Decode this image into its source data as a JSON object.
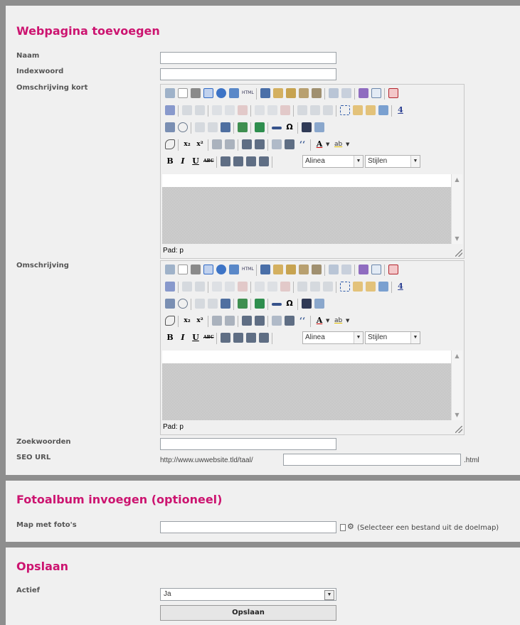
{
  "page": {
    "section_titles": {
      "add_page": "Webpagina toevoegen",
      "photo_album": "Fotoalbum invoegen (optioneel)",
      "save": "Opslaan"
    },
    "labels": {
      "name": "Naam",
      "index_word": "Indexwoord",
      "short_description": "Omschrijving kort",
      "description": "Omschrijving",
      "keywords": "Zoekwoorden",
      "seo_url": "SEO URL",
      "photo_folder": "Map met foto's",
      "active": "Actief"
    },
    "fields": {
      "name": "",
      "index_word": "",
      "keywords": "",
      "seo_url_value": "",
      "photo_folder": ""
    },
    "seo": {
      "prefix": "http://www.uwwebsite.tld/taal/",
      "suffix": ".html"
    },
    "photo_hint": "(Selecteer een bestand uit de doelmap)",
    "active_select": {
      "selected": "Ja"
    },
    "save_button": "Opslaan"
  },
  "editor": {
    "format_select": "Alinea",
    "styles_select": "Stijlen",
    "path_label": "Pad: p",
    "toolbar_text_glyphs": {
      "bold": "B",
      "italic": "I",
      "underline": "U",
      "strike": "ABC",
      "special_char": "Ω",
      "html": "HTML",
      "abbr": "4",
      "quote": "‘‘"
    }
  }
}
